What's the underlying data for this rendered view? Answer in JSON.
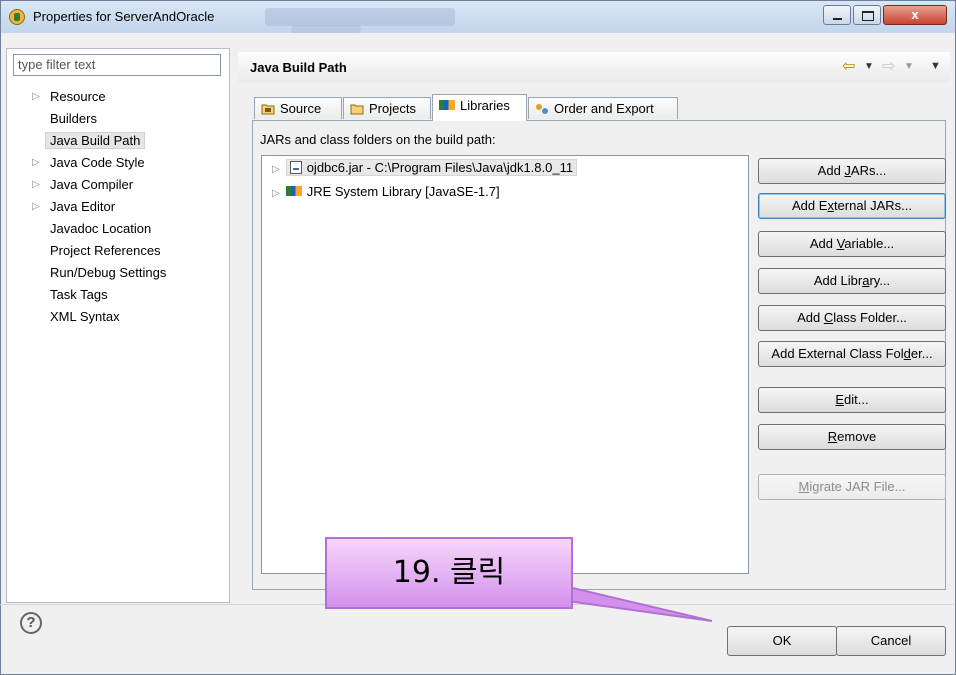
{
  "window": {
    "title": "Properties for ServerAndOracle",
    "close_label": "x"
  },
  "sidebar": {
    "filter_placeholder": "type filter text",
    "items": [
      {
        "label": "Resource",
        "expandable": true
      },
      {
        "label": "Builders",
        "expandable": false
      },
      {
        "label": "Java Build Path",
        "expandable": false,
        "selected": true
      },
      {
        "label": "Java Code Style",
        "expandable": true
      },
      {
        "label": "Java Compiler",
        "expandable": true
      },
      {
        "label": "Java Editor",
        "expandable": true
      },
      {
        "label": "Javadoc Location",
        "expandable": false
      },
      {
        "label": "Project References",
        "expandable": false
      },
      {
        "label": "Run/Debug Settings",
        "expandable": false
      },
      {
        "label": "Task Tags",
        "expandable": false
      },
      {
        "label": "XML Syntax",
        "expandable": false
      }
    ]
  },
  "page": {
    "title": "Java Build Path",
    "tabs": [
      {
        "label": "Source",
        "icon": "source-icon"
      },
      {
        "label": "Projects",
        "icon": "projects-icon"
      },
      {
        "label": "Libraries",
        "icon": "libraries-icon",
        "active": true
      },
      {
        "label": "Order and Export",
        "icon": "order-export-icon"
      }
    ],
    "list_label": "JARs and class folders on the build path:",
    "entries": [
      {
        "label": "ojdbc6.jar - C:\\Program Files\\Java\\jdk1.8.0_11",
        "icon": "jar-icon"
      },
      {
        "label": "JRE System Library [JavaSE-1.7]",
        "icon": "library-icon"
      }
    ],
    "buttons": {
      "add_jars": {
        "pre": "Add ",
        "u": "J",
        "post": "ARs..."
      },
      "add_external_jars": {
        "pre": "Add E",
        "u": "x",
        "post": "ternal JARs..."
      },
      "add_variable": {
        "pre": "Add ",
        "u": "V",
        "post": "ariable..."
      },
      "add_library": {
        "pre": "Add Libr",
        "u": "a",
        "post": "ry..."
      },
      "add_class_folder": {
        "pre": "Add ",
        "u": "C",
        "post": "lass Folder..."
      },
      "add_external_class_folder": {
        "pre": "Add External Class Fol",
        "u": "d",
        "post": "er..."
      },
      "edit": {
        "pre": "",
        "u": "E",
        "post": "dit..."
      },
      "remove": {
        "pre": "",
        "u": "R",
        "post": "emove"
      },
      "migrate": {
        "pre": "",
        "u": "M",
        "post": "igrate JAR File..."
      }
    }
  },
  "footer": {
    "help": "?",
    "ok": "OK",
    "cancel": "Cancel"
  },
  "callout": {
    "text": "19. 클릭"
  }
}
